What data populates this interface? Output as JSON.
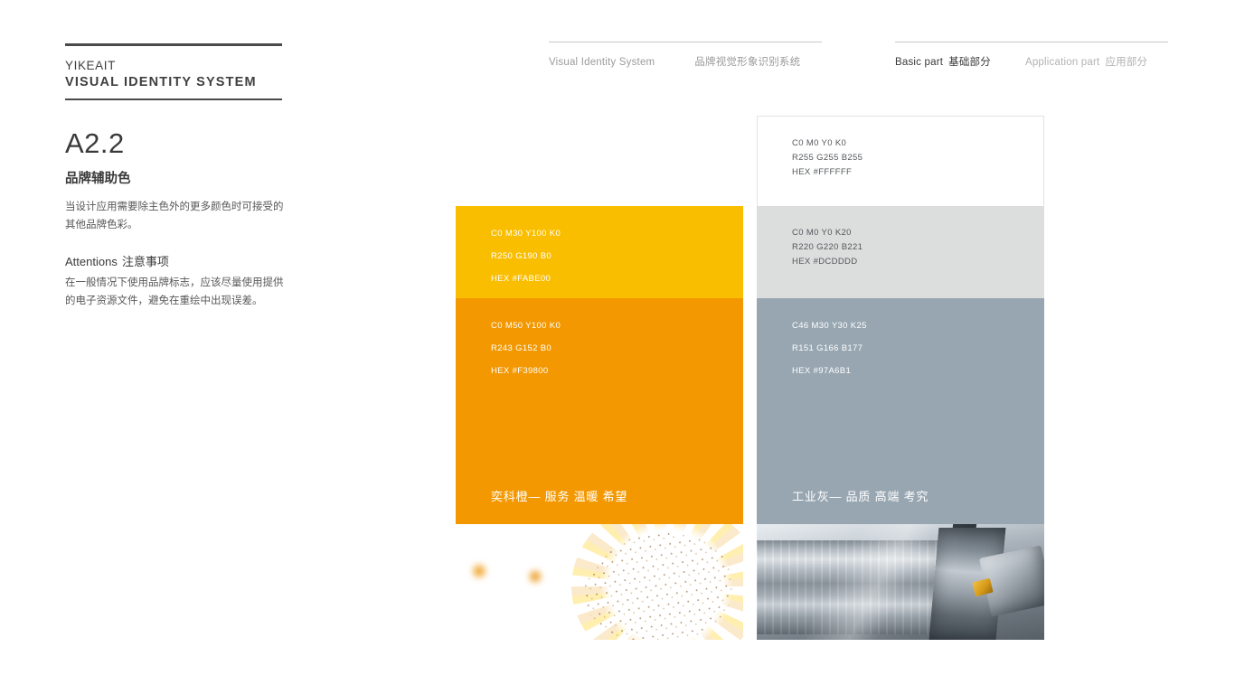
{
  "brand": {
    "name": "YIKEAIT",
    "system": "VISUAL IDENTITY SYSTEM"
  },
  "header": {
    "left_nav": {
      "en": "Visual Identity System",
      "cn": "品牌视觉形象识别系统"
    },
    "right_nav": {
      "basic_en": "Basic part",
      "basic_cn": "基础部分",
      "application_en": "Application part",
      "application_cn": "应用部分"
    }
  },
  "info": {
    "code": "A2.2",
    "subtitle": "品牌辅助色",
    "body": "当设计应用需要除主色外的更多颜色时可接受的其他品牌色彩。",
    "attentions_en": "Attentions",
    "attentions_cn": "注意事项",
    "attentions_body": "在一般情况下使用品牌标志，应该尽量使用提供的电子资源文件，避免在重绘中出现误差。"
  },
  "swatches": {
    "yellow": {
      "cmyk": "C0 M30 Y100 K0",
      "rgb": "R250 G190 B0",
      "hex_label": "HEX #FABE00",
      "hex": "#FABE00"
    },
    "orange": {
      "cmyk": "C0 M50 Y100 K0",
      "rgb": "R243 G152 B0",
      "hex_label": "HEX #F39800",
      "hex": "#F39800",
      "name": "奕科橙— 服务 温暖 希望"
    },
    "white": {
      "cmyk": "C0 M0 Y0 K0",
      "rgb": "R255 G255 B255",
      "hex_label": "HEX #FFFFFF",
      "hex": "#FFFFFF"
    },
    "light_gray": {
      "cmyk": "C0 M0 Y0 K20",
      "rgb": "R220 G220 B221",
      "hex_label": "HEX #DCDDDD",
      "hex": "#DCDDDD"
    },
    "blue_gray": {
      "cmyk": "C46 M30 Y30 K25",
      "rgb": "R151 G166 B177",
      "hex_label": "HEX #97A6B1",
      "hex": "#97A6B1",
      "name": "工业灰— 品质 高端 考究"
    }
  },
  "photos": {
    "sunflower_alt": "sunflower-close-up-photo",
    "metal_alt": "metal-lathe-machining-photo"
  }
}
